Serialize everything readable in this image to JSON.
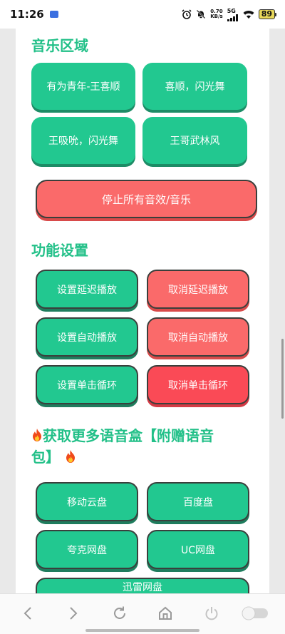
{
  "status_bar": {
    "time": "11:26",
    "speed_value": "0.70",
    "speed_unit": "KB/s",
    "network": "5G",
    "battery": "89"
  },
  "music_section": {
    "title": "音乐区域",
    "buttons": [
      "有为青年-王喜顺",
      "喜顺，闪光舞",
      "王吸吮，闪光舞",
      "王哥武林风"
    ],
    "stop_button": "停止所有音效/音乐"
  },
  "settings_section": {
    "title": "功能设置",
    "set_delay": "设置延迟播放",
    "cancel_delay": "取消延迟播放",
    "set_auto": "设置自动播放",
    "cancel_auto": "取消自动播放",
    "set_loop": "设置单击循环",
    "cancel_loop": "取消单击循环"
  },
  "more_section": {
    "title_line1": "获取更多语音盒【附赠语音",
    "title_line2": "包】",
    "buttons": [
      "移动云盘",
      "百度盘",
      "夸克网盘",
      "UC网盘",
      "迅雷网盘"
    ]
  },
  "colors": {
    "accent_green": "#22c890",
    "accent_red": "#fa6a6a",
    "title_green": "#22c088"
  }
}
